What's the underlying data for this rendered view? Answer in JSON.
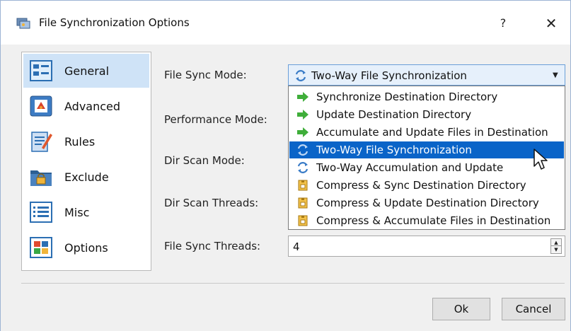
{
  "window": {
    "title": "File Synchronization Options",
    "help_label": "?",
    "close_label": "✕"
  },
  "sidebar": {
    "items": [
      {
        "label": "General",
        "icon": "general-icon",
        "selected": true
      },
      {
        "label": "Advanced",
        "icon": "advanced-icon",
        "selected": false
      },
      {
        "label": "Rules",
        "icon": "rules-icon",
        "selected": false
      },
      {
        "label": "Exclude",
        "icon": "exclude-lock-icon",
        "selected": false
      },
      {
        "label": "Misc",
        "icon": "misc-list-icon",
        "selected": false
      },
      {
        "label": "Options",
        "icon": "options-grid-icon",
        "selected": false
      }
    ]
  },
  "form": {
    "labels": {
      "file_sync_mode": "File Sync Mode:",
      "performance_mode": "Performance Mode:",
      "dir_scan_mode": "Dir Scan Mode:",
      "dir_scan_threads": "Dir Scan Threads:",
      "file_sync_threads": "File Sync Threads:"
    },
    "file_sync_mode_value": "Two-Way File Synchronization",
    "file_sync_threads_value": "4"
  },
  "dropdown": {
    "highlighted_index": 3,
    "options": [
      {
        "label": "Synchronize Destination Directory",
        "icon": "green-arrow-icon"
      },
      {
        "label": "Update Destination Directory",
        "icon": "green-arrow-icon"
      },
      {
        "label": "Accumulate and Update Files in Destination",
        "icon": "green-arrow-icon"
      },
      {
        "label": "Two-Way File Synchronization",
        "icon": "two-way-sync-icon"
      },
      {
        "label": "Two-Way Accumulation and Update",
        "icon": "two-way-sync-icon"
      },
      {
        "label": "Compress & Sync Destination Directory",
        "icon": "archive-icon"
      },
      {
        "label": "Compress & Update Destination Directory",
        "icon": "archive-icon"
      },
      {
        "label": "Compress & Accumulate Files in Destination",
        "icon": "archive-icon"
      }
    ]
  },
  "buttons": {
    "ok": "Ok",
    "cancel": "Cancel"
  },
  "colors": {
    "selection": "#0a64c8",
    "sidebar_selected": "#cfe3f7",
    "window_bg": "#f0f0f0"
  }
}
